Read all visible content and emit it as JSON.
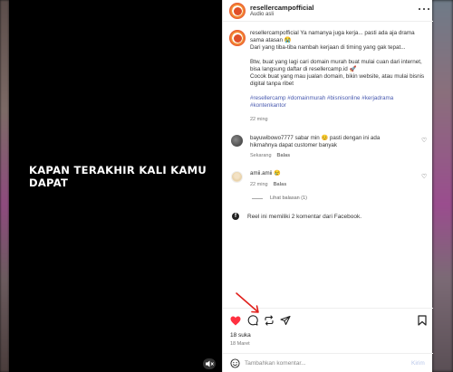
{
  "video": {
    "caption": "KAPAN TERAKHIR KALI KAMU DAPAT"
  },
  "header": {
    "username": "resellercampofficial",
    "audio": "Audio asli"
  },
  "caption": {
    "username": "resellercampofficial",
    "line1": "Ya namanya juga kerja... pasti ada aja drama sama atasan 😭",
    "line2": "Dari yang tiba-tiba nambah kerjaan di timing yang gak tepat...",
    "para2": "Btw, buat yang lagi cari domain murah buat mulai cuan dari internet, bisa langsung daftar di resellercamp.id 🚀\nCocok buat yang mau jualan domain, bikin website, atau mulai bisnis digital tanpa ribet",
    "hashtags": "#resellercamp #domainmurah #bisnisonline #kerjadrama #kontenkantor",
    "time": "22 ming"
  },
  "comments": [
    {
      "username": "bayuwibowo7777",
      "text": "sabar min 😊 pasti dengan ini ada hikmahnya dapat customer banyak",
      "time": "Sekarang",
      "reply": "Balas"
    },
    {
      "username": "amii.amii",
      "text": "😢",
      "time": "22 ming",
      "reply": "Balas"
    }
  ],
  "view_replies": "Lihat balasan (1)",
  "fb_note": "Reel ini memiliki 2 komentar dari Facebook.",
  "likes": "18 suka",
  "date": "18 Maret",
  "comment_input": {
    "placeholder": "Tambahkan komentar..."
  },
  "post_label": "Kirim",
  "colors": {
    "like_red": "#ff3040",
    "link_blue": "#4a5bb0",
    "arrow_red": "#e0201c"
  }
}
